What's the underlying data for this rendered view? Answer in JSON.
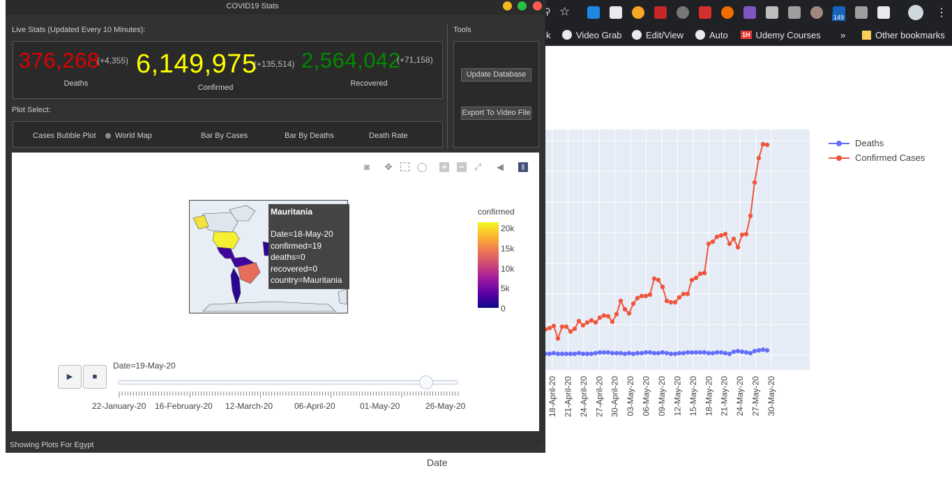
{
  "browser": {
    "ext_badge": "149",
    "bookmarks": [
      {
        "label": "k"
      },
      {
        "label": "Video Grab"
      },
      {
        "label": "Edit/View"
      },
      {
        "label": "Auto"
      },
      {
        "label": "Udemy Courses",
        "icon_text": "1H"
      },
      {
        "label": "»"
      },
      {
        "label": "Other bookmarks"
      }
    ]
  },
  "bg_chart": {
    "xlabel": "Date",
    "x_ticks": [
      "18-April-20",
      "21-April-20",
      "24-April-20",
      "27-April-20",
      "30-April-20",
      "03-May-20",
      "06-May-20",
      "09-May-20",
      "12-May-20",
      "15-May-20",
      "18-May-20",
      "21-May-20",
      "24-May-20",
      "27-May-20",
      "30-May-20"
    ],
    "legend": [
      {
        "name": "Deaths",
        "color": "#636efa"
      },
      {
        "name": "Confirmed Cases",
        "color": "#ef553b"
      }
    ]
  },
  "app": {
    "title": "COVID19 Stats",
    "live_stats_label": "Live Stats (Updated Every 10 Minutes):",
    "tools_label": "Tools",
    "stats": {
      "deaths": {
        "value": "376,268",
        "delta": "(+4,355)",
        "caption": "Deaths",
        "color": "#e00000"
      },
      "confirmed": {
        "value": "6,149,975",
        "delta": "(+135,514)",
        "caption": "Confirmed",
        "color": "#ffff00"
      },
      "recovered": {
        "value": "2,564,042",
        "delta": "(+71,158)",
        "caption": "Recovered",
        "color": "#008a00"
      }
    },
    "plot_select_label": "Plot Select:",
    "plot_options": [
      {
        "label": "Cases Bubble Plot",
        "selected": false
      },
      {
        "label": "World Map",
        "selected": true
      },
      {
        "label": "Bar By Cases",
        "selected": false
      },
      {
        "label": "Bar By Deaths",
        "selected": false
      },
      {
        "label": "Death Rate",
        "selected": false
      }
    ],
    "tools": {
      "update_db": "Update Database",
      "export_video": "Export To Video File"
    },
    "status": "Showing Plots For Egypt"
  },
  "map_plot": {
    "colorbar_title": "confirmed",
    "colorbar_ticks": [
      "20k",
      "15k",
      "10k",
      "5k",
      "0"
    ],
    "tooltip": {
      "title": "Mauritania",
      "lines": [
        "Date=18-May-20",
        "confirmed=19",
        "deaths=0",
        "recovered=0",
        "country=Mauritania"
      ]
    },
    "slider": {
      "current_label": "Date=19-May-20",
      "tick_labels": [
        "22-January-20",
        "16-February-20",
        "12-March-20",
        "06-April-20",
        "01-May-20",
        "26-May-20"
      ],
      "position_fraction": 0.906
    },
    "play_icon": "play-icon",
    "stop_icon": "stop-icon"
  }
}
